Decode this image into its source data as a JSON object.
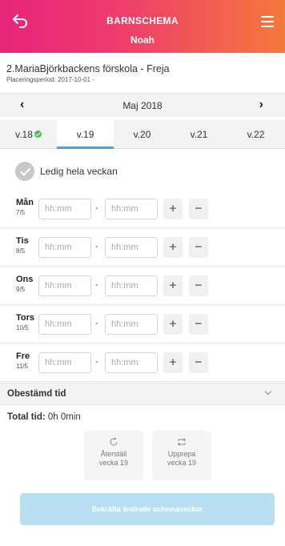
{
  "header": {
    "title": "BARNSCHEMA",
    "child_name": "Noah",
    "back_icon": "back-arrow-icon",
    "menu_icon": "hamburger-menu-icon"
  },
  "placement": {
    "name": "2.MariaBjörkbackens förskola - Freja",
    "period": "Placeringsperiod: 2017-10-01 -"
  },
  "month_nav": {
    "prev": "‹",
    "label": "Maj 2018",
    "next": "›"
  },
  "weeks": [
    {
      "label": "v.18",
      "confirmed": true,
      "active": false
    },
    {
      "label": "v.19",
      "confirmed": false,
      "active": true
    },
    {
      "label": "v.20",
      "confirmed": false,
      "active": false
    },
    {
      "label": "v.21",
      "confirmed": false,
      "active": false
    },
    {
      "label": "v.22",
      "confirmed": false,
      "active": false
    }
  ],
  "free_week": {
    "label": "Ledig hela veckan",
    "checked": false
  },
  "days": [
    {
      "name": "Mån",
      "date": "7/5",
      "from_placeholder": "hh:mm",
      "to_placeholder": "hh:mm",
      "separator": "-",
      "plus": "+",
      "minus": "−"
    },
    {
      "name": "Tis",
      "date": "8/5",
      "from_placeholder": "hh:mm",
      "to_placeholder": "hh:mm",
      "separator": "-",
      "plus": "+",
      "minus": "−"
    },
    {
      "name": "Ons",
      "date": "9/5",
      "from_placeholder": "hh:mm",
      "to_placeholder": "hh:mm",
      "separator": "-",
      "plus": "+",
      "minus": "−"
    },
    {
      "name": "Tors",
      "date": "10/5",
      "from_placeholder": "hh:mm",
      "to_placeholder": "hh:mm",
      "separator": "-",
      "plus": "+",
      "minus": "−"
    },
    {
      "name": "Fre",
      "date": "11/5",
      "from_placeholder": "hh:mm",
      "to_placeholder": "hh:mm",
      "separator": "-",
      "plus": "+",
      "minus": "−"
    }
  ],
  "undetermined": {
    "label": "Obestämd tid"
  },
  "total": {
    "label": "Total tid:",
    "value": "0h 0min"
  },
  "actions": {
    "reset": {
      "line1": "Återställ",
      "line2": "vecka 19",
      "icon": "reset-icon"
    },
    "repeat": {
      "line1": "Upprepa",
      "line2": "vecka 19",
      "icon": "repeat-icon"
    }
  },
  "confirm": {
    "label": "Bekräfta ändrade schemaveckor"
  },
  "colors": {
    "header_gradient_start": "#e8237a",
    "header_gradient_end": "#f47a3c",
    "active_week_underline": "#4aa3df",
    "check_green": "#4cbb5a",
    "confirm_button": "#b9dff3"
  }
}
